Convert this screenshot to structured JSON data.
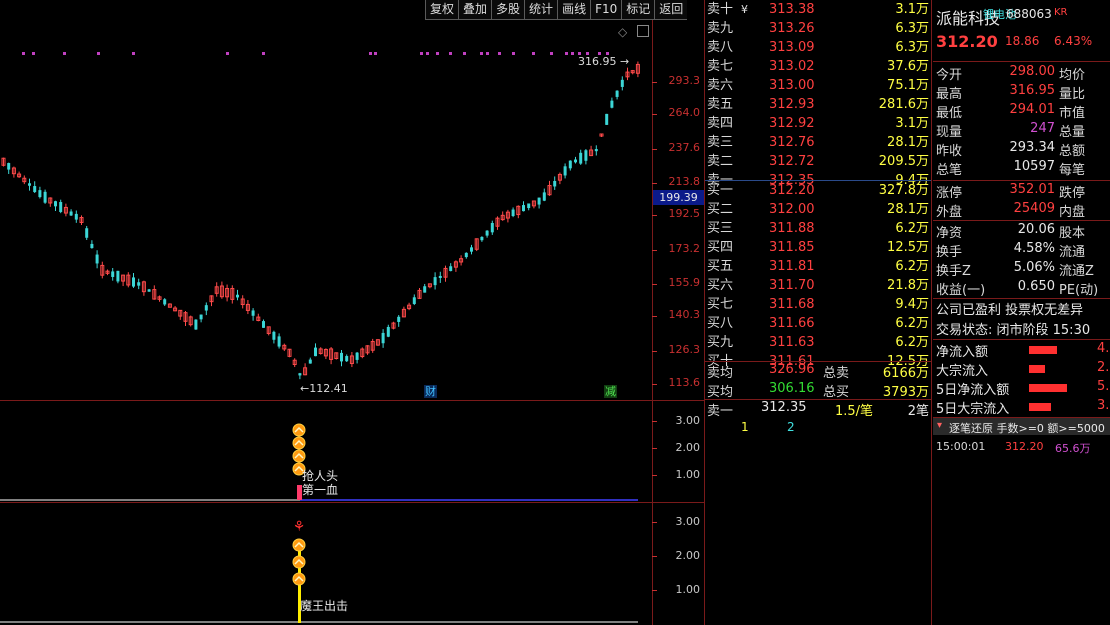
{
  "toolbar": [
    "复权",
    "叠加",
    "多股",
    "统计",
    "画线",
    "F10",
    "标记",
    "返回"
  ],
  "chart": {
    "y_labels": [
      "293.3",
      "264.0",
      "237.6",
      "213.8",
      "192.5",
      "173.2",
      "155.9",
      "140.3",
      "126.3",
      "113.6"
    ],
    "current_price_tag": "199.39",
    "high_label": "316.95",
    "low_label": "112.41",
    "badge_cai": "财",
    "badge_jian": "减"
  },
  "ind1": {
    "y_labels": [
      "3.00",
      "2.00",
      "1.00"
    ],
    "text1": "抢人头",
    "text2": "第一血"
  },
  "ind2": {
    "y_labels": [
      "3.00",
      "2.00",
      "1.00"
    ],
    "text1": "魔王出击"
  },
  "orderbook": {
    "sells": [
      {
        "name": "卖十",
        "price": "313.38",
        "vol": "3.1万",
        "mark": "¥"
      },
      {
        "name": "卖九",
        "price": "313.26",
        "vol": "6.3万"
      },
      {
        "name": "卖八",
        "price": "313.09",
        "vol": "6.3万"
      },
      {
        "name": "卖七",
        "price": "313.02",
        "vol": "37.6万"
      },
      {
        "name": "卖六",
        "price": "313.00",
        "vol": "75.1万"
      },
      {
        "name": "卖五",
        "price": "312.93",
        "vol": "281.6万"
      },
      {
        "name": "卖四",
        "price": "312.92",
        "vol": "3.1万"
      },
      {
        "name": "卖三",
        "price": "312.76",
        "vol": "28.1万"
      },
      {
        "name": "卖二",
        "price": "312.72",
        "vol": "209.5万"
      },
      {
        "name": "卖一",
        "price": "312.35",
        "vol": "9.4万"
      }
    ],
    "buys": [
      {
        "name": "买一",
        "price": "312.20",
        "vol": "327.8万"
      },
      {
        "name": "买二",
        "price": "312.00",
        "vol": "28.1万"
      },
      {
        "name": "买三",
        "price": "311.88",
        "vol": "6.2万"
      },
      {
        "name": "买四",
        "price": "311.85",
        "vol": "12.5万"
      },
      {
        "name": "买五",
        "price": "311.81",
        "vol": "6.2万"
      },
      {
        "name": "买六",
        "price": "311.70",
        "vol": "21.8万"
      },
      {
        "name": "买七",
        "price": "311.68",
        "vol": "9.4万"
      },
      {
        "name": "买八",
        "price": "311.66",
        "vol": "6.2万"
      },
      {
        "name": "买九",
        "price": "311.63",
        "vol": "6.2万"
      },
      {
        "name": "买十",
        "price": "311.61",
        "vol": "12.5万"
      }
    ],
    "avg_sell_label": "卖均",
    "avg_sell": "326.96",
    "total_sell_label": "总卖",
    "total_sell": "6166万",
    "avg_buy_label": "买均",
    "avg_buy": "306.16",
    "total_buy_label": "总买",
    "total_buy": "3793万",
    "foot_label": "卖一",
    "foot_price": "312.35",
    "foot_mid": "1.5/笔",
    "foot_right": "2笔",
    "tabs": [
      "1",
      "2"
    ]
  },
  "info": {
    "name": "派能科技",
    "concept": "锂电池",
    "code": "688063",
    "kr": "KR",
    "price": "312.20",
    "change": "18.86",
    "pct": "6.43%",
    "rows1": [
      {
        "k": "今开",
        "v": "298.00",
        "k2": "均价",
        "c": "red"
      },
      {
        "k": "最高",
        "v": "316.95",
        "k2": "量比",
        "c": "red"
      },
      {
        "k": "最低",
        "v": "294.01",
        "k2": "市值",
        "c": "red"
      },
      {
        "k": "现量",
        "v": "247",
        "k2": "总量",
        "c": "mag"
      },
      {
        "k": "昨收",
        "v": "293.34",
        "k2": "总额",
        "c": "wht"
      },
      {
        "k": "总笔",
        "v": "10597",
        "k2": "每笔",
        "c": "wht"
      }
    ],
    "rows2": [
      {
        "k": "涨停",
        "v": "352.01",
        "k2": "跌停",
        "c": "red"
      },
      {
        "k": "外盘",
        "v": "25409",
        "k2": "内盘",
        "c": "red"
      }
    ],
    "rows3": [
      {
        "k": "净资",
        "v": "20.06",
        "k2": "股本",
        "c": "wht"
      },
      {
        "k": "换手",
        "v": "4.58%",
        "k2": "流通",
        "c": "wht"
      },
      {
        "k": "换手Z",
        "v": "5.06%",
        "k2": "流通Z",
        "c": "wht"
      },
      {
        "k": "收益(一)",
        "v": "0.650",
        "k2": "PE(动)",
        "c": "wht"
      }
    ],
    "note": "公司已盈利 投票权无差异",
    "trade_state": "交易状态: 闭市阶段 15:30",
    "flows": [
      {
        "k": "净流入额",
        "v": "4.",
        "w": 28
      },
      {
        "k": "大宗流入",
        "v": "2.",
        "w": 16
      },
      {
        "k": "5日净流入额",
        "v": "5.",
        "w": 38
      },
      {
        "k": "5日大宗流入",
        "v": "3.",
        "w": 22
      }
    ],
    "tick_header": "逐笔还原  手数>=0 额>=5000",
    "tick_time": "15:00:01",
    "tick_price": "312.20",
    "tick_vol": "65.6万"
  }
}
